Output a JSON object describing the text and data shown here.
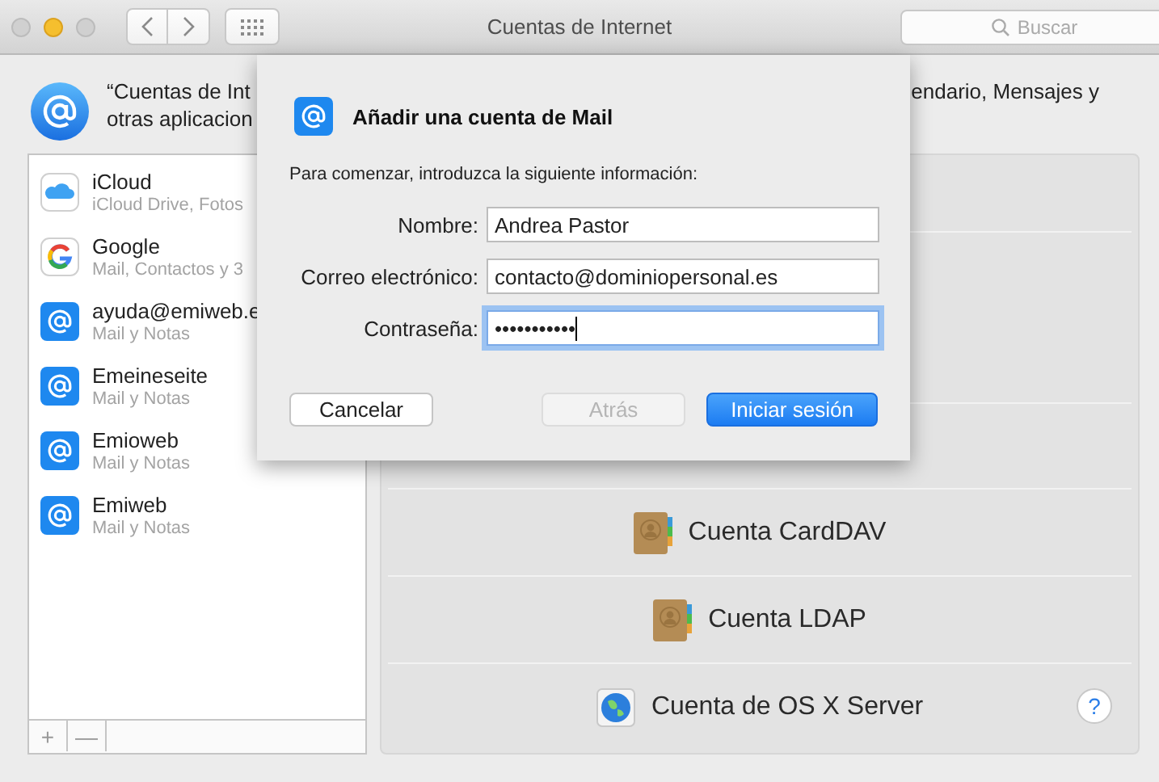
{
  "window": {
    "title": "Cuentas de Internet"
  },
  "search": {
    "placeholder": "Buscar"
  },
  "description": {
    "left_lines": [
      "“Cuentas de Int",
      "otras aplicacion"
    ],
    "right_line": "endario, Mensajes y"
  },
  "accounts": [
    {
      "name": "iCloud",
      "detail": "iCloud Drive, Fotos",
      "kind": "icloud",
      "selected": false
    },
    {
      "name": "Google",
      "detail": "Mail, Contactos y 3",
      "kind": "google",
      "selected": false
    },
    {
      "name": "ayuda@emiweb.e",
      "detail": "Mail y Notas",
      "kind": "mail",
      "selected": false
    },
    {
      "name": "Emeineseite",
      "detail": "Mail y Notas",
      "kind": "mail",
      "selected": false
    },
    {
      "name": "Emioweb",
      "detail": "Mail y Notas",
      "kind": "mail",
      "selected": false
    },
    {
      "name": "Emiweb",
      "detail": "Mail y Notas",
      "kind": "mail",
      "selected": false
    }
  ],
  "list_buttons": [
    "+",
    "—"
  ],
  "services": [
    {
      "label": "Cuenta CardDAV",
      "kind": "contacts"
    },
    {
      "label": "Cuenta LDAP",
      "kind": "contacts"
    },
    {
      "label": "Cuenta de OS X Server",
      "kind": "server"
    }
  ],
  "help": "?",
  "sheet": {
    "title": "Añadir una cuenta de Mail",
    "instruction": "Para comenzar, introduzca la siguiente información:",
    "fields": [
      {
        "label": "Nombre:",
        "value": "Andrea Pastor",
        "focused": false
      },
      {
        "label": "Correo electrónico:",
        "value": "contacto@dominiopersonal.es",
        "focused": false
      },
      {
        "label": "Contraseña:",
        "value": "•••••••••••",
        "focused": true
      }
    ],
    "buttons": [
      {
        "label": "Cancelar",
        "kind": "normal",
        "disabled": false
      },
      {
        "label": "Atrás",
        "kind": "normal",
        "disabled": true
      },
      {
        "label": "Iniciar sesión",
        "kind": "default",
        "disabled": false
      }
    ]
  }
}
